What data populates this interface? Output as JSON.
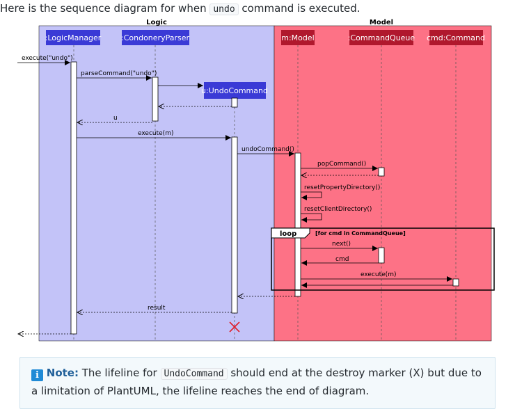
{
  "intro": {
    "before": "Here is the sequence diagram for when ",
    "code": "undo",
    "after": " command is executed."
  },
  "diagram": {
    "groups": [
      {
        "title": "Logic",
        "color": "#c3c3f8"
      },
      {
        "title": "Model",
        "color": "#fd7286"
      }
    ],
    "participants": [
      {
        "label": ":LogicManager",
        "color": "#3a3ad6"
      },
      {
        "label": ":CondoneryParser",
        "color": "#3a3ad6"
      },
      {
        "label": "u:UndoCommand",
        "color": "#3a3ad6"
      },
      {
        "label": "m:Model",
        "color": "#b0182d"
      },
      {
        "label": ":CommandQueue",
        "color": "#b0182d"
      },
      {
        "label": "cmd:Command",
        "color": "#b0182d"
      }
    ],
    "messages": {
      "execute_undo": "execute(\"undo\")",
      "parse_command": "parseCommand(\"undo\")",
      "return_u": "u",
      "execute_m": "execute(m)",
      "undo_command": "undoCommand()",
      "pop_command": "popCommand()",
      "reset_property": "resetPropertyDirectory()",
      "reset_client": "resetClientDirectory()",
      "next": "next()",
      "return_cmd": "cmd",
      "execute_m_cmd": "execute(m)",
      "result": "result"
    },
    "loop": {
      "keyword": "loop",
      "guard": "[for cmd in CommandQueue]"
    }
  },
  "note": {
    "icon": "i",
    "label": "Note:",
    "text1": " The lifeline for ",
    "code": "UndoCommand",
    "text2": " should end at the destroy marker (X) but due to a limitation of PlantUML, the lifeline reaches the end of diagram."
  }
}
